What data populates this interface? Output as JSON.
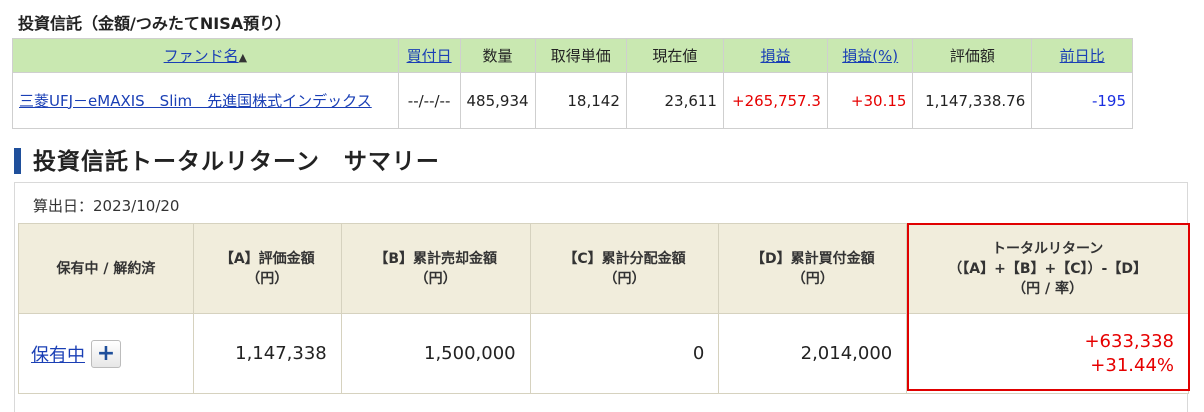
{
  "section_title": "投資信託（金額/つみたてNISA預り）",
  "fund_table": {
    "headers": {
      "fund_name": "ファンド名",
      "purchase_date": "買付日",
      "quantity": "数量",
      "unit_cost": "取得単価",
      "current_price": "現在値",
      "profit_loss": "損益",
      "profit_loss_pct": "損益(%)",
      "valuation": "評価額",
      "day_change": "前日比"
    },
    "sort_indicator": "▲",
    "row": {
      "fund_name": "三菱UFJ－eMAXIS　Slim　先進国株式インデックス",
      "purchase_date": "--/--/--",
      "quantity": "485,934",
      "unit_cost": "18,142",
      "current_price": "23,611",
      "profit_loss": "+265,757.3",
      "profit_loss_pct": "+30.15",
      "valuation": "1,147,338.76",
      "day_change": "-195"
    }
  },
  "summary": {
    "heading": "投資信託トータルリターン　サマリー",
    "calc_date": "算出日：2023/10/20",
    "headers": {
      "status": "保有中 / 解約済",
      "a_line1": "【A】評価金額",
      "a_line2": "（円）",
      "b_line1": "【B】累計売却金額",
      "b_line2": "（円）",
      "c_line1": "【C】累計分配金額",
      "c_line2": "（円）",
      "d_line1": "【D】累計買付金額",
      "d_line2": "（円）",
      "tr_line1": "トータルリターン",
      "tr_line2": "（【A】+【B】+【C】）-【D】",
      "tr_line3": "（円 / 率）"
    },
    "row": {
      "status": "保有中",
      "expand_label": "+",
      "a": "1,147,338",
      "b": "1,500,000",
      "c": "0",
      "d": "2,014,000",
      "total_return_amount": "+633,338",
      "total_return_rate": "+31.44%"
    }
  },
  "colors": {
    "fund_header_bg": "#c9e8b1",
    "summary_header_bg": "#f1eddc",
    "positive": "#e60000",
    "negative": "#1a2fe0",
    "link": "#1a3fb5",
    "highlight_border": "#e00000",
    "accent_bar": "#1f4f9b"
  }
}
